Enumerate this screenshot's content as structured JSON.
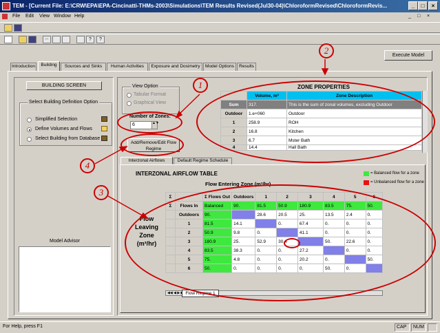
{
  "window": {
    "title": "TEM - [Current File:  E:\\CRW\\EPA\\EPA-Cincinatti-THMs-2003\\Simulations\\TEM Results Revised(Jul30-04)\\ChloroformRevised\\ChloroformRevis..."
  },
  "menu": [
    "File",
    "Edit",
    "View",
    "Window",
    "Help"
  ],
  "execute_label": "Execute Model",
  "tabs": [
    "Introduction",
    "Building",
    "Sources and Sinks",
    "Human Activities",
    "Exposure and Dosimetry",
    "Model Options",
    "Results"
  ],
  "left": {
    "building_screen": "BUILDING SCREEN",
    "group_title": "Select Building Definition Option",
    "options": [
      "Simplified Selection",
      "Define Volumes and Flows",
      "Select Building from Database"
    ],
    "advisor_label": "Model Advisor"
  },
  "view_option": {
    "title": "View Option",
    "tabular": "Tabular Format",
    "graphical": "Graphical View"
  },
  "zones": {
    "label": "Number of Zones:",
    "value": "6",
    "add_remove_label": "Add/Remove/Edit Flow Regime"
  },
  "zone_properties": {
    "title": "ZONE PROPERTIES",
    "col_volume": "Volume, m³",
    "col_desc": "Zone Description",
    "rows": [
      {
        "name": "Sum",
        "volume": "317.",
        "desc": "This is the sum of zonal volumes, excluding Outdoor"
      },
      {
        "name": "Outdoor",
        "volume": "1.e+060",
        "desc": "Outdoor"
      },
      {
        "name": "1",
        "volume": "258.9",
        "desc": "ROH"
      },
      {
        "name": "2",
        "volume": "16.8",
        "desc": "Kitchen"
      },
      {
        "name": "3",
        "volume": "6.7",
        "desc": "Mster Bath"
      },
      {
        "name": "4",
        "volume": "14.4",
        "desc": "Hall Bath"
      }
    ]
  },
  "subtabs": [
    "Interzonal Airflows",
    "Default Regime Schedule"
  ],
  "airflow": {
    "title": "INTERZONAL AIRFLOW TABLE",
    "entering": "Flow Entering Zone (m³/hr)",
    "leaving": "Flow Leaving Zone (m³/hr)",
    "legend_balanced": "= Balanced flow for a zone",
    "legend_unbalanced": "= Unbalanced flow for a zone",
    "col_headers": [
      "Σ  Flows Out",
      "Outdoors",
      "1",
      "2",
      "3",
      "4",
      "5",
      "6"
    ],
    "flows_in_label": "Flows In",
    "flows_in": [
      "Balanced",
      "90.",
      "81.5",
      "50.9",
      "180.9",
      "83.5",
      "75.",
      "50."
    ],
    "rows": [
      {
        "name": "Outdoors",
        "out": "90.",
        "cells": [
          "",
          "28.6",
          "20.5",
          "25.",
          "13.5",
          "2.4",
          "0."
        ]
      },
      {
        "name": "1",
        "out": "81.5",
        "cells": [
          "14.1",
          "",
          "0.",
          "67.4",
          "0.",
          "0.",
          "0."
        ]
      },
      {
        "name": "2",
        "out": "50.9",
        "cells": [
          "9.8",
          "0.",
          "",
          "41.1",
          "0.",
          "0.",
          "0."
        ]
      },
      {
        "name": "3",
        "out": "180.9",
        "cells": [
          "25.",
          "52.9",
          "30.4",
          "",
          "50.",
          "22.6",
          "0."
        ]
      },
      {
        "name": "4",
        "out": "83.5",
        "cells": [
          "38.3",
          "0.",
          "0.",
          "27.2",
          "",
          "0.",
          "0."
        ]
      },
      {
        "name": "5",
        "out": "75.",
        "cells": [
          "4.8",
          "0.",
          "0.",
          "20.2",
          "0.",
          "",
          "50."
        ]
      },
      {
        "name": "6",
        "out": "50.",
        "cells": [
          "0.",
          "0.",
          "0.",
          "0.",
          "50.",
          "0.",
          ""
        ]
      }
    ],
    "regime_tab": "Flow Regime 1"
  },
  "annotations": [
    "1",
    "2",
    "3",
    "4"
  ],
  "status": {
    "help": "For Help, press F1",
    "cap": "CAP",
    "num": "NUM"
  },
  "colors": {
    "balanced": "#3fe83f",
    "unbalanced": "#e81010",
    "diag": "#8080e8",
    "annot": "#cc0000"
  }
}
